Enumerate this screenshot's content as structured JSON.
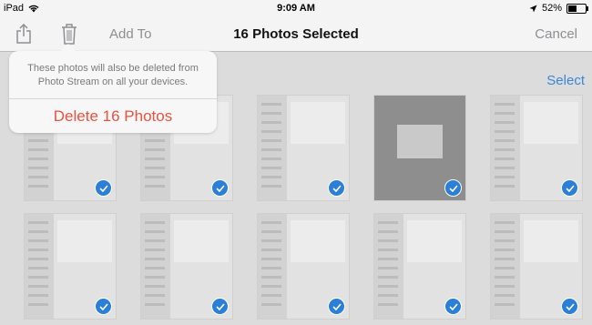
{
  "status_bar": {
    "device": "iPad",
    "time": "9:09 AM",
    "battery_text": "52%",
    "battery_level": 0.52
  },
  "toolbar": {
    "title": "16 Photos Selected",
    "add_to": "Add To",
    "cancel": "Cancel",
    "share_icon": "share-icon",
    "trash_icon": "trash-icon"
  },
  "popover": {
    "message": "These photos will also be deleted from Photo Stream on all your devices.",
    "delete_button": "Delete 16 Photos"
  },
  "main": {
    "select": "Select"
  },
  "photos": [
    {
      "selected": true,
      "style": "settings"
    },
    {
      "selected": true,
      "style": "settings"
    },
    {
      "selected": true,
      "style": "settings"
    },
    {
      "selected": true,
      "style": "dark"
    },
    {
      "selected": true,
      "style": "settings"
    },
    {
      "selected": true,
      "style": "settings"
    },
    {
      "selected": true,
      "style": "settings"
    },
    {
      "selected": true,
      "style": "settings"
    },
    {
      "selected": true,
      "style": "settings"
    },
    {
      "selected": true,
      "style": "settings"
    }
  ],
  "colors": {
    "accent": "#3a87d8",
    "destructive": "#e8523f",
    "check": "#2b7fd4"
  }
}
